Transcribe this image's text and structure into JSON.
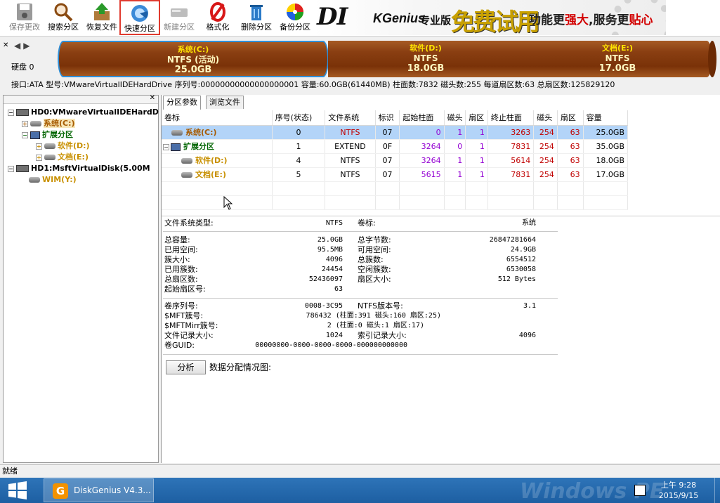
{
  "toolbar": {
    "buttons": [
      {
        "label": "保存更改",
        "icon": "save-disk-icon"
      },
      {
        "label": "搜索分区",
        "icon": "magnifier-icon"
      },
      {
        "label": "恢复文件",
        "icon": "restore-box-icon"
      },
      {
        "label": "快速分区",
        "icon": "quick-partition-icon"
      },
      {
        "label": "新建分区",
        "icon": "new-partition-icon"
      },
      {
        "label": "格式化",
        "icon": "format-icon"
      },
      {
        "label": "删除分区",
        "icon": "trash-icon"
      },
      {
        "label": "备份分区",
        "icon": "backup-disc-icon"
      }
    ],
    "banner": {
      "logo_d": "DI",
      "logo_genius": "KGenius",
      "edition": "专业版",
      "trial": "免费试用",
      "slogan_a": "功能更",
      "slogan_b": "强大",
      "slogan_c": ",服务更",
      "slogan_d": "贴心"
    }
  },
  "diskbar": {
    "disk_label": "硬盘 0",
    "partitions": [
      {
        "name": "系统(C:)",
        "fs": "NTFS (活动)",
        "size": "25.0GB"
      },
      {
        "name": "软件(D:)",
        "fs": "NTFS",
        "size": "18.0GB"
      },
      {
        "name": "文档(E:)",
        "fs": "NTFS",
        "size": "17.0GB"
      }
    ]
  },
  "diskinfo": {
    "text": "接口:ATA  型号:VMwareVirtualIDEHardDrive  序列号:00000000000000000001  容量:60.0GB(61440MB)  柱面数:7832  磁头数:255  每道扇区数:63  总扇区数:125829120"
  },
  "tree": {
    "hd0": "HD0:VMwareVirtualIDEHardD",
    "sys": "系统(C:)",
    "ext": "扩展分区",
    "soft": "软件(D:)",
    "doc": "文档(E:)",
    "hd1": "HD1:MsftVirtualDisk(5.00M",
    "wim": "WIM(Y:)"
  },
  "tabs": [
    "分区参数",
    "浏览文件"
  ],
  "table": {
    "headers": [
      "卷标",
      "序号(状态)",
      "文件系统",
      "标识",
      "起始柱面",
      "磁头",
      "扇区",
      "终止柱面",
      "磁头",
      "扇区",
      "容量"
    ],
    "rows": [
      [
        "系统(C:)",
        "0",
        "NTFS",
        "07",
        "0",
        "1",
        "1",
        "3263",
        "254",
        "63",
        "25.0GB"
      ],
      [
        "扩展分区",
        "1",
        "EXTEND",
        "0F",
        "3264",
        "0",
        "1",
        "7831",
        "254",
        "63",
        "35.0GB"
      ],
      [
        "软件(D:)",
        "4",
        "NTFS",
        "07",
        "3264",
        "1",
        "1",
        "5614",
        "254",
        "63",
        "18.0GB"
      ],
      [
        "文档(E:)",
        "5",
        "NTFS",
        "07",
        "5615",
        "1",
        "1",
        "7831",
        "254",
        "63",
        "17.0GB"
      ]
    ]
  },
  "detail": {
    "fs_type_label": "文件系统类型:",
    "fs_type": "NTFS",
    "vol_label_label": "卷标:",
    "vol_label": "系统",
    "total_cap_label": "总容量:",
    "total_cap": "25.0GB",
    "total_bytes_label": "总字节数:",
    "total_bytes": "26847281664",
    "used_label": "已用空间:",
    "used": "95.5MB",
    "free_label": "可用空间:",
    "free": "24.9GB",
    "cluster_label": "簇大小:",
    "cluster": "4096",
    "total_clusters_label": "总簇数:",
    "total_clusters": "6554512",
    "used_clusters_label": "已用簇数:",
    "used_clusters": "24454",
    "free_clusters_label": "空闲簇数:",
    "free_clusters": "6530058",
    "total_sectors_label": "总扇区数:",
    "total_sectors": "52436097",
    "sector_size_label": "扇区大小:",
    "sector_size": "512 Bytes",
    "start_sector_label": "起始扇区号:",
    "start_sector": "63",
    "serial_label": "卷序列号:",
    "serial": "0008-3C95",
    "ntfs_ver_label": "NTFS版本号:",
    "ntfs_ver": "3.1",
    "mft_label": "$MFT簇号:",
    "mft": "786432 (柱面:391 磁头:160 扇区:25)",
    "mftmirr_label": "$MFTMirr簇号:",
    "mftmirr": "2 (柱面:0 磁头:1 扇区:17)",
    "file_rec_label": "文件记录大小:",
    "file_rec": "1024",
    "index_rec_label": "索引记录大小:",
    "index_rec": "4096",
    "guid_label": "卷GUID:",
    "guid": "00000000-0000-0000-0000-000000000000",
    "analyze": "分析",
    "dist_label": "数据分配情况图:"
  },
  "status": "就绪",
  "taskbar": {
    "app": "DiskGenius V4.3...",
    "watermark": "Windows PE",
    "time": "上午 9:28",
    "date": "2015/9/15"
  }
}
